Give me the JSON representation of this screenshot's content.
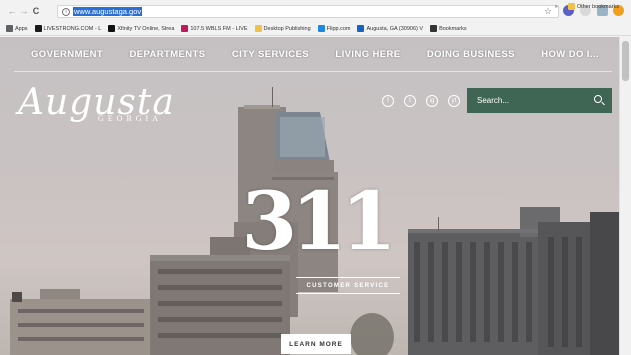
{
  "browser": {
    "url": "www.augustaga.gov",
    "nav": {
      "back": "←",
      "forward": "→",
      "reload": "C"
    }
  },
  "bookmarks": {
    "items": [
      {
        "label": "Apps",
        "color": "#5f6368"
      },
      {
        "label": "LIVESTRONG.COM - L",
        "color": "#1a1a1a"
      },
      {
        "label": "Xfinity TV Online, Strea",
        "color": "#111111"
      },
      {
        "label": "107.5 WBLS FM - LIVE",
        "color": "#c2185b"
      },
      {
        "label": "Desktop Publishing",
        "color": "#f0c14b"
      },
      {
        "label": "Flipp.com",
        "color": "#1e88e5"
      },
      {
        "label": "Augusta, GA (30906) V",
        "color": "#1565c0"
      },
      {
        "label": "Bookmarks",
        "color": "#333333"
      }
    ],
    "more": "»",
    "other": "Other bookmarks"
  },
  "site": {
    "nav": [
      "GOVERNMENT",
      "DEPARTMENTS",
      "CITY SERVICES",
      "LIVING HERE",
      "DOING BUSINESS",
      "HOW DO I..."
    ],
    "logo": {
      "script": "Augusta",
      "state": "GEORGIA"
    },
    "social": [
      "f",
      "t",
      "ig",
      "yt"
    ],
    "search_placeholder": "Search...",
    "hero": {
      "number": "311",
      "subtitle": "CUSTOMER SERVICE",
      "button": "LEARN MORE"
    }
  },
  "colors": {
    "search_bg": "#3f6655",
    "url_highlight": "#2a6fd6"
  }
}
